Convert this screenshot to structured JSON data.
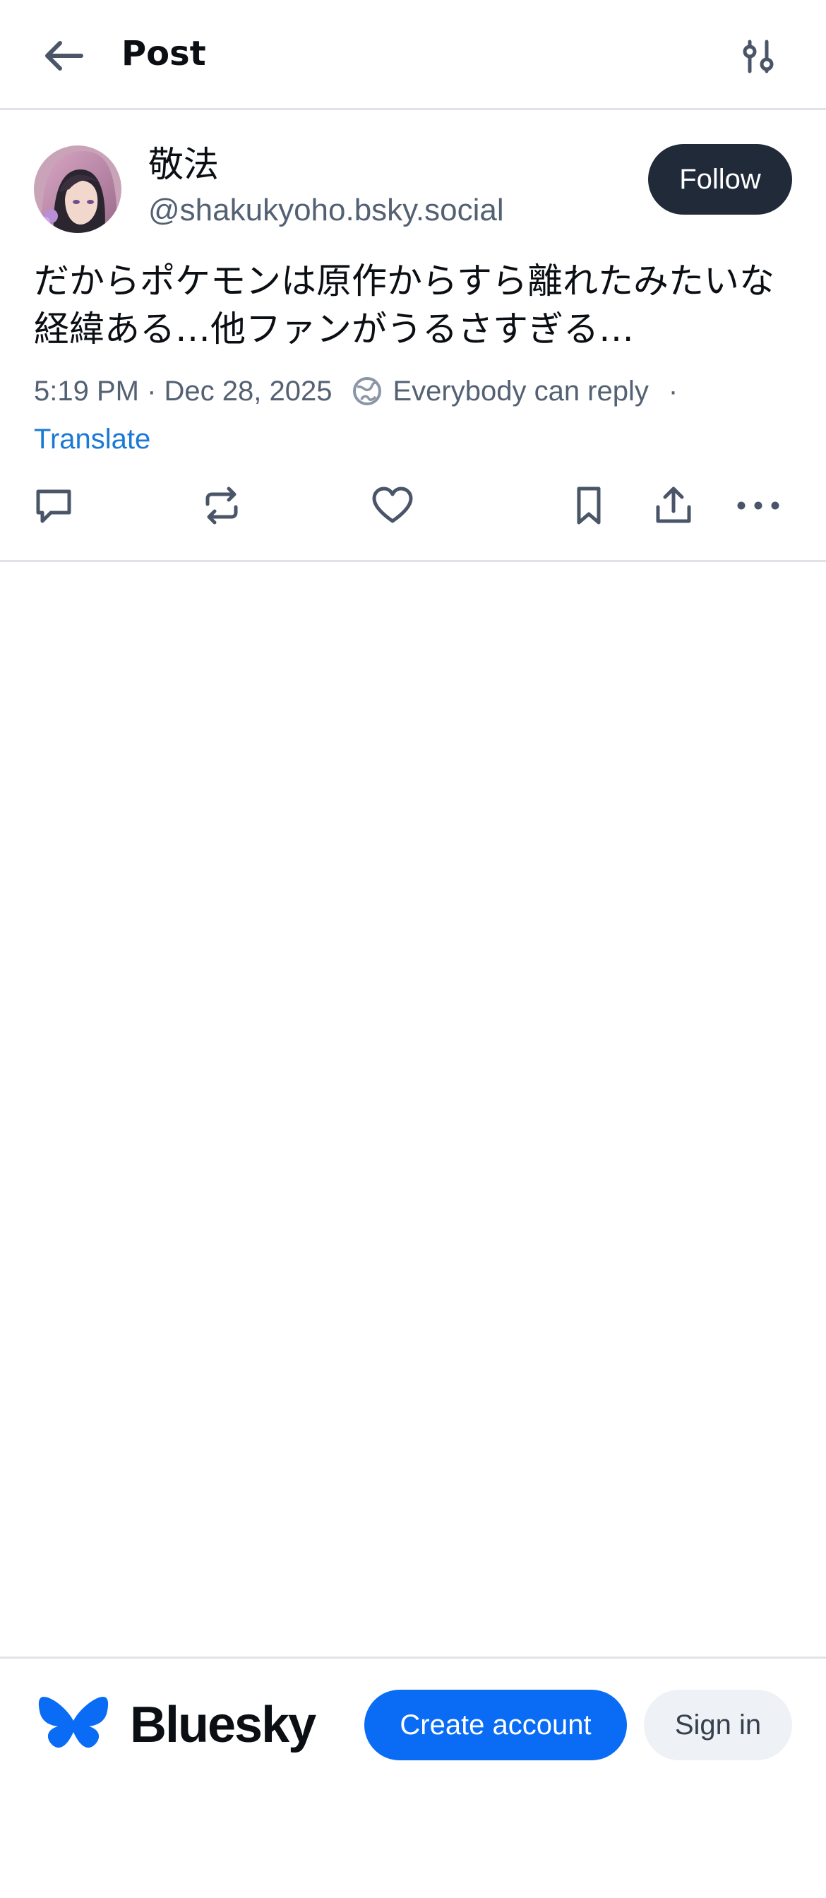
{
  "header": {
    "back_icon": "arrow-left-icon",
    "title": "Post",
    "filter_icon": "sliders-icon"
  },
  "post": {
    "author": {
      "display_name": "敬法",
      "handle": "@shakukyoho.bsky.social",
      "avatar": "anime-avatar"
    },
    "follow_label": "Follow",
    "text": "だからポケモンは原作からすら離れたみたいな経緯ある…他ファンがうるさすぎる…",
    "timestamp": "5:19 PM · Dec 28, 2025",
    "reply_setting": "Everybody can reply",
    "separator": "·",
    "translate_label": "Translate",
    "actions": {
      "reply_icon": "comment-icon",
      "repost_icon": "repost-icon",
      "like_icon": "heart-icon",
      "bookmark_icon": "bookmark-icon",
      "share_icon": "share-icon",
      "more_icon": "more-dots-icon"
    }
  },
  "footer": {
    "brand": "Bluesky",
    "create_account_label": "Create account",
    "sign_in_label": "Sign in"
  },
  "colors": {
    "accent": "#0a6cf5",
    "link": "#1a78d6",
    "follow_bg": "#202a38",
    "muted_text": "#536173",
    "divider": "#dfe3e8"
  }
}
